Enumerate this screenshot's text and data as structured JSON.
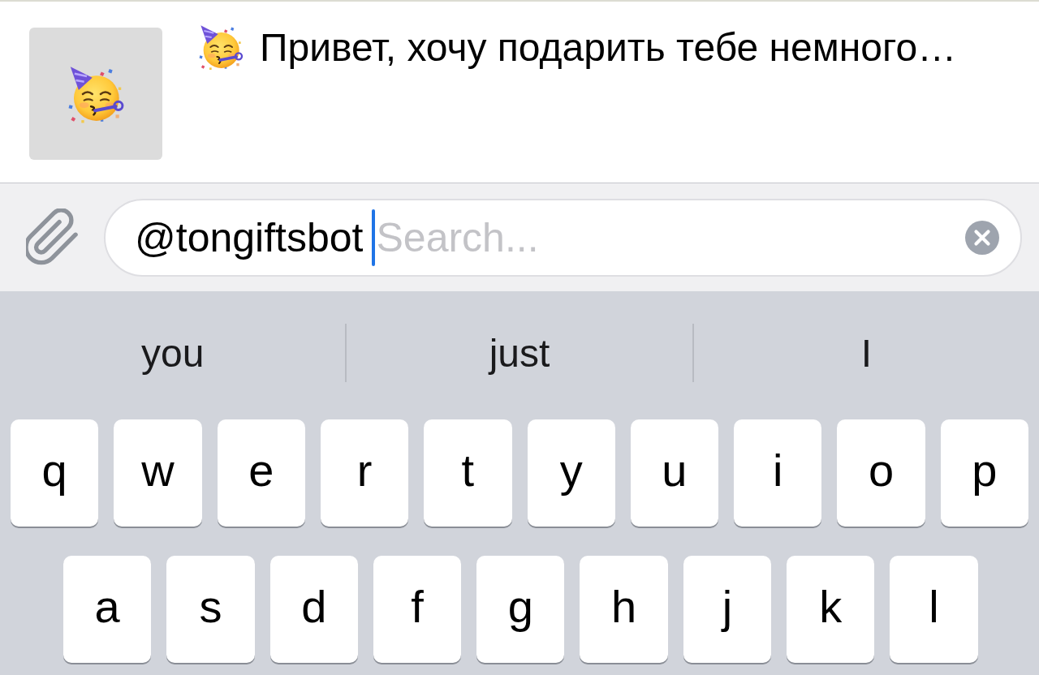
{
  "message_preview": {
    "text": "Привет, хочу подарить тебе немного…"
  },
  "composer": {
    "query": "@tongiftsbot",
    "placeholder": "Search...",
    "focused": true
  },
  "keyboard": {
    "suggestions": [
      "you",
      "just",
      "I"
    ],
    "rows": [
      [
        "q",
        "w",
        "e",
        "r",
        "t",
        "y",
        "u",
        "i",
        "o",
        "p"
      ],
      [
        "a",
        "s",
        "d",
        "f",
        "g",
        "h",
        "j",
        "k",
        "l"
      ]
    ]
  }
}
